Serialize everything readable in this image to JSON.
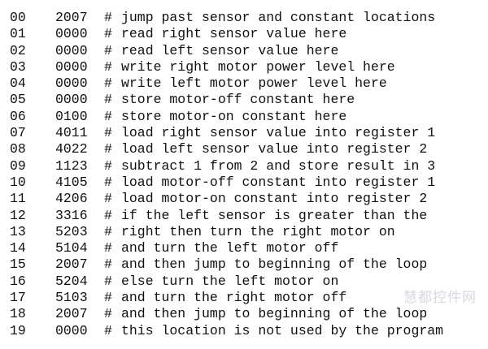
{
  "program": {
    "rows": [
      {
        "addr": "00",
        "word": "2007",
        "hash": "#",
        "comment": "jump past sensor and constant locations"
      },
      {
        "addr": "01",
        "word": "0000",
        "hash": "#",
        "comment": "read right sensor value here"
      },
      {
        "addr": "02",
        "word": "0000",
        "hash": "#",
        "comment": "read left sensor value here"
      },
      {
        "addr": "03",
        "word": "0000",
        "hash": "#",
        "comment": "write right motor power level here"
      },
      {
        "addr": "04",
        "word": "0000",
        "hash": "#",
        "comment": "write left motor power level here"
      },
      {
        "addr": "05",
        "word": "0000",
        "hash": "#",
        "comment": "store motor-off constant here"
      },
      {
        "addr": "06",
        "word": "0100",
        "hash": "#",
        "comment": "store motor-on constant here"
      },
      {
        "addr": "07",
        "word": "4011",
        "hash": "#",
        "comment": "load right sensor value into register 1"
      },
      {
        "addr": "08",
        "word": "4022",
        "hash": "#",
        "comment": "load left sensor value into register 2"
      },
      {
        "addr": "09",
        "word": "1123",
        "hash": "#",
        "comment": "subtract 1 from 2 and store result in 3"
      },
      {
        "addr": "10",
        "word": "4105",
        "hash": "#",
        "comment": "load motor-off constant into register 1"
      },
      {
        "addr": "11",
        "word": "4206",
        "hash": "#",
        "comment": "load motor-on constant into register 2"
      },
      {
        "addr": "12",
        "word": "3316",
        "hash": "#",
        "comment": "if the left sensor is greater than the"
      },
      {
        "addr": "13",
        "word": "5203",
        "hash": "#",
        "comment": "right then turn the right motor on"
      },
      {
        "addr": "14",
        "word": "5104",
        "hash": "#",
        "comment": "and turn the left motor off"
      },
      {
        "addr": "15",
        "word": "2007",
        "hash": "#",
        "comment": "and then jump to beginning of the loop"
      },
      {
        "addr": "16",
        "word": "5204",
        "hash": "#",
        "comment": "else turn the left motor on"
      },
      {
        "addr": "17",
        "word": "5103",
        "hash": "#",
        "comment": "and turn the right motor off"
      },
      {
        "addr": "18",
        "word": "2007",
        "hash": "#",
        "comment": "and then jump to beginning of the loop"
      },
      {
        "addr": "19",
        "word": "0000",
        "hash": "#",
        "comment": "this location is not used by the program"
      }
    ]
  },
  "watermark": {
    "text": "慧都控件网"
  }
}
